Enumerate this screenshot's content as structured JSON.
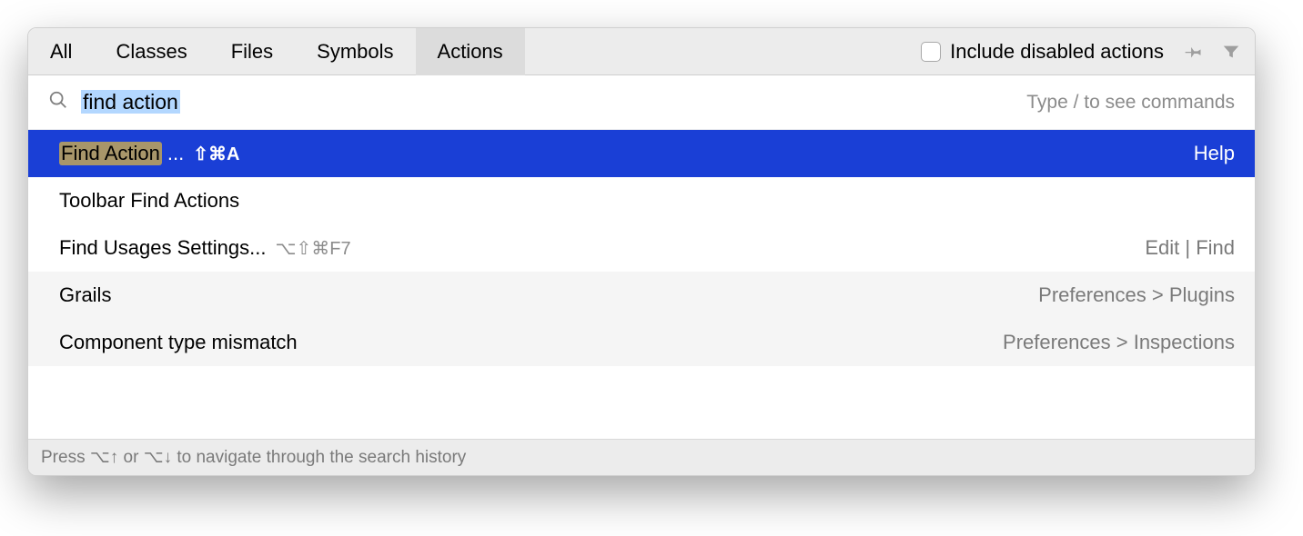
{
  "tabs": {
    "all": "All",
    "classes": "Classes",
    "files": "Files",
    "symbols": "Symbols",
    "actions": "Actions",
    "active": "actions"
  },
  "checkbox": {
    "label": "Include disabled actions",
    "checked": false
  },
  "search": {
    "value": "find action",
    "hint": "Type / to see commands"
  },
  "results": [
    {
      "highlight": "Find Action",
      "suffix": "...",
      "shortcut": "⇧⌘A",
      "right": "Help",
      "selected": true
    },
    {
      "label": "Toolbar Find Actions",
      "right": ""
    },
    {
      "label": "Find Usages Settings...",
      "shortcut": "⌥⇧⌘F7",
      "shortcut_dim": true,
      "right": "Edit | Find"
    },
    {
      "label": "Grails",
      "right": "Preferences > Plugins",
      "alt": true
    },
    {
      "label": "Component type mismatch",
      "right": "Preferences > Inspections",
      "alt": true
    }
  ],
  "footer": {
    "text": "Press ⌥↑ or ⌥↓ to navigate through the search history"
  },
  "icons": {
    "pin": "pin",
    "filter": "filter",
    "search": "search"
  }
}
